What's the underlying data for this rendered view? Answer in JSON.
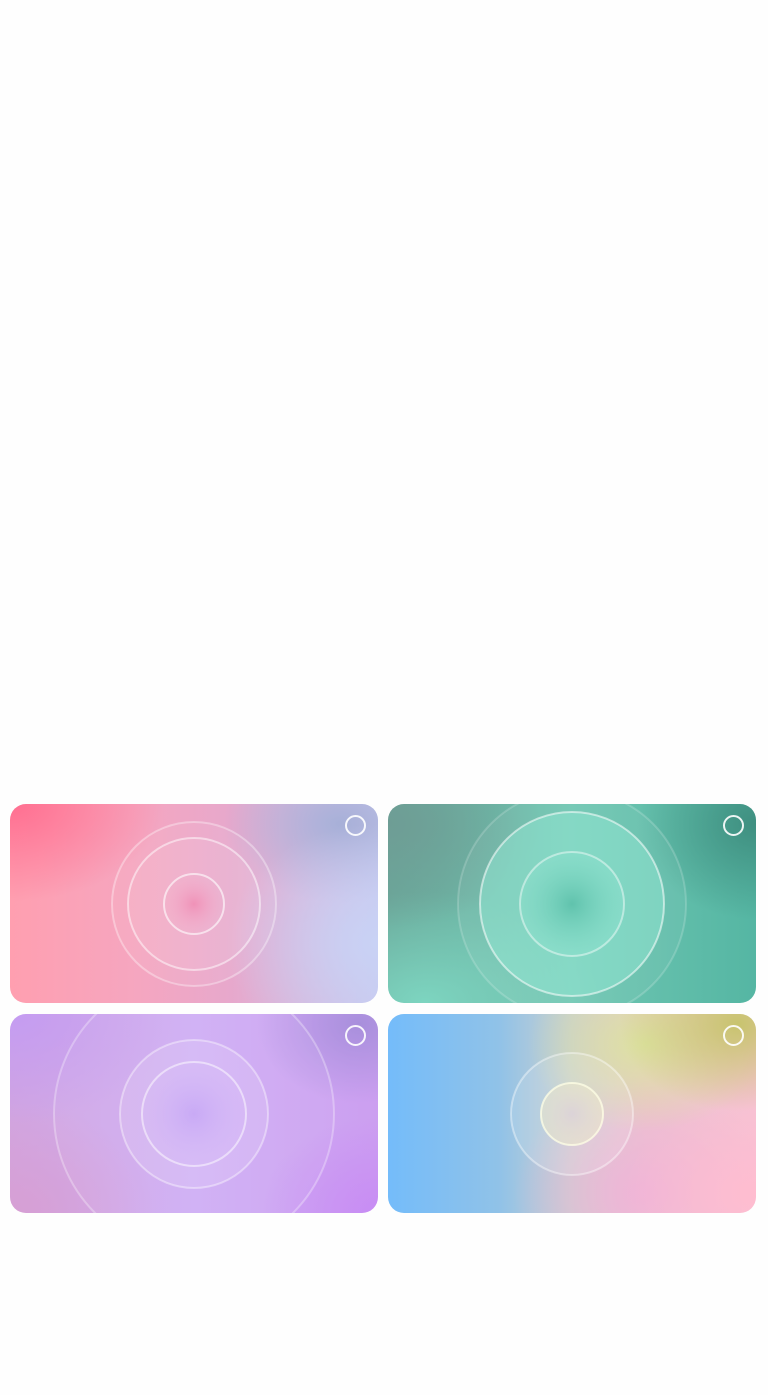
{
  "wallpaper_grid": {
    "cards": [
      {
        "name": "wallpaper-card-pink",
        "theme": "pink-lavender",
        "colors": [
          "#ff6f91",
          "#f5a6c0",
          "#c8c8ee"
        ],
        "selected": false
      },
      {
        "name": "wallpaper-card-teal",
        "theme": "teal",
        "colors": [
          "#6e9d95",
          "#6fc6b2",
          "#55b6a3"
        ],
        "selected": false
      },
      {
        "name": "wallpaper-card-purple",
        "theme": "purple",
        "colors": [
          "#c49cf2",
          "#cfaef5",
          "#c88cf4"
        ],
        "selected": false
      },
      {
        "name": "wallpaper-card-rainbow",
        "theme": "blue-yellow-pink",
        "colors": [
          "#74bcfa",
          "#dce3a0",
          "#f7c2d4"
        ],
        "selected": false
      }
    ],
    "selection_icon": "circle-outline-icon"
  }
}
